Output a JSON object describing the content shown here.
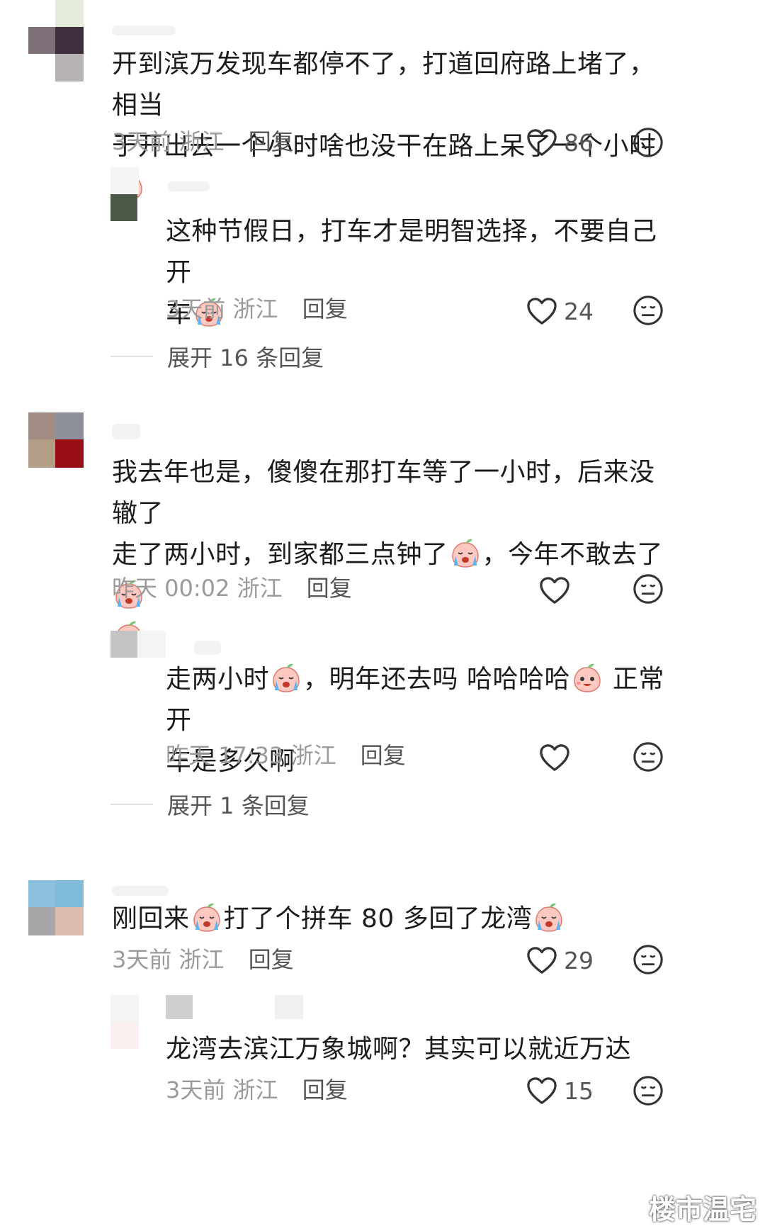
{
  "comments": [
    {
      "text_lines": [
        "开到滨万发现车都停不了，打道回府路上堵了，相当",
        "于开出去一个小时啥也没干在路上呆了一个小时"
      ],
      "meta": "3天前 浙江",
      "reply_label": "回复",
      "likes": "86"
    },
    {
      "text_lines": [
        "这种节假日，打车才是明智选择，不要自己开",
        "车"
      ],
      "meta": "3天前 浙江",
      "reply_label": "回复",
      "likes": "24"
    },
    {
      "text_lines": [
        "我去年也是，傻傻在那打车等了一小时，后来没辙了",
        "走了两小时，到家都三点钟了",
        "，今年不敢去了"
      ],
      "meta": "昨天 00:02 浙江",
      "reply_label": "回复",
      "likes": ""
    },
    {
      "text_lines": [
        "走两小时",
        "，明年还去吗 哈哈哈哈",
        " 正常开",
        "车是多久啊"
      ],
      "meta": "昨天 17:33 浙江",
      "reply_label": "回复",
      "likes": ""
    },
    {
      "text_lines": [
        "刚回来",
        "打了个拼车 80 多回了龙湾"
      ],
      "meta": "3天前 浙江",
      "reply_label": "回复",
      "likes": "29"
    },
    {
      "text_lines": [
        "龙湾去滨江万象城啊？其实可以就近万达"
      ],
      "meta": "3天前 浙江",
      "reply_label": "回复",
      "likes": "15"
    }
  ],
  "expand_replies": [
    "展开 16 条回复",
    "展开 1 条回复"
  ],
  "watermark": "楼市温宅",
  "icons": {
    "like": "heart-outline-icon",
    "dislike": "meh-face-icon",
    "emoji_smile": "peach-blush-emoji",
    "emoji_cry": "peach-crying-emoji",
    "emoji_laugh": "peach-laugh-emoji"
  },
  "colors": {
    "text": "#1c1c1c",
    "meta": "#9a9a9a",
    "icon": "#333333"
  }
}
